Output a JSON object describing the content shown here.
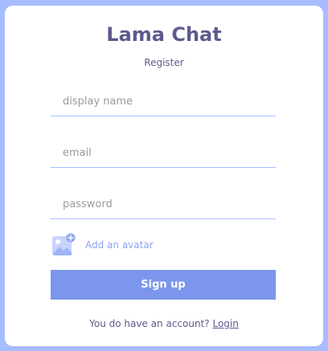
{
  "app": {
    "logo": "Lama Chat",
    "subtitle": "Register"
  },
  "form": {
    "display_name": {
      "placeholder": "display name",
      "value": ""
    },
    "email": {
      "placeholder": "email",
      "value": ""
    },
    "password": {
      "placeholder": "password",
      "value": ""
    },
    "avatar": {
      "label": "Add an avatar",
      "icon": "add-image-icon"
    },
    "submit_label": "Sign up"
  },
  "footer": {
    "text": "You do have an account?",
    "link_label": "Login"
  },
  "colors": {
    "background": "#a7bcff",
    "brand": "#5d5b8d",
    "button": "#7b96ec",
    "accent": "#8da4f1"
  }
}
